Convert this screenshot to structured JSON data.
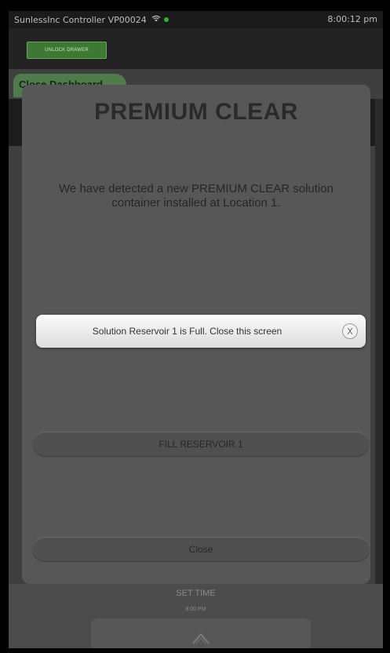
{
  "status_bar": {
    "title": "SunlessInc Controller  VP00024",
    "wifi_icon": "wifi-icon",
    "time": "8:00:12 pm"
  },
  "top_bar": {
    "unlock_label": "UNLOCK DRAWER"
  },
  "dashboard": {
    "tab_label": "Close Dashboard",
    "set_time_label": "SET TIME",
    "time_value": "8:00 PM"
  },
  "modal": {
    "title": "PREMIUM CLEAR",
    "message": "We have detected a new PREMIUM CLEAR solution container installed at Location 1.",
    "fill_button": "FILL RESERVOIR 1",
    "close_button": "Close"
  },
  "toast": {
    "text": "Solution Reservoir 1 is Full. Close this screen",
    "close_glyph": "X"
  },
  "colors": {
    "accent_green": "#3c7a33",
    "modal_bg": "#575757",
    "toast_bg": "#f0f0f0"
  }
}
